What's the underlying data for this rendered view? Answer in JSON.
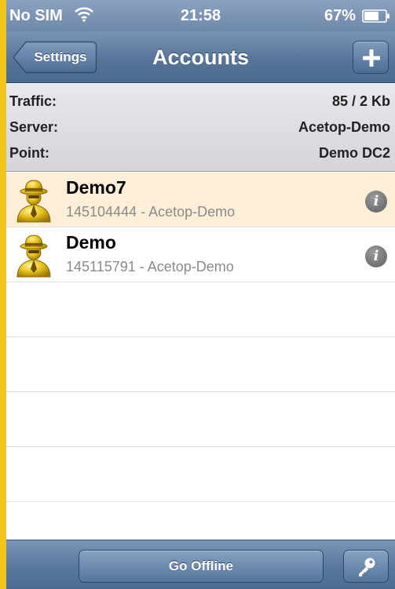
{
  "status_bar": {
    "carrier": "No SIM",
    "time": "21:58",
    "battery": "67%",
    "icons": [
      "wifi-icon",
      "battery-icon"
    ]
  },
  "nav": {
    "back_label": "Settings",
    "title": "Accounts",
    "add_icon": "plus-icon"
  },
  "info": [
    {
      "label": "Traffic:",
      "value": "85 / 2 Kb"
    },
    {
      "label": "Server:",
      "value": "Acetop-Demo"
    },
    {
      "label": "Point:",
      "value": "Demo DC2"
    }
  ],
  "accounts": [
    {
      "name": "Demo7",
      "detail": "145104444 - Acetop-Demo",
      "selected": true
    },
    {
      "name": "Demo",
      "detail": "145115791 - Acetop-Demo",
      "selected": false
    }
  ],
  "toolbar": {
    "offline_label": "Go Offline",
    "key_icon": "key-icon"
  },
  "colors": {
    "frame": "#f0c418",
    "nav": "#577498",
    "selected_row": "#fdeed8",
    "secondary_text": "#8a8a8a"
  }
}
